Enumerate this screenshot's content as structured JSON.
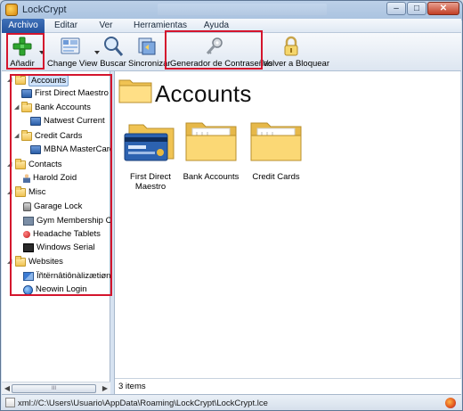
{
  "window": {
    "title": "LockCrypt",
    "minimize": "–",
    "maximize": "□",
    "close": "✕"
  },
  "menu": [
    "Archivo",
    "Editar",
    "Ver",
    "Herramientas",
    "Ayuda"
  ],
  "toolbar": {
    "add": "Añadir",
    "change_view": "Change View",
    "search": "Buscar",
    "sync": "Sincronizar",
    "password_generator": "Generador de Contraseñas",
    "lock": "Volver a Bloquear"
  },
  "tree": {
    "accounts": "Accounts",
    "first_direct": "First Direct Maestro",
    "bank_accounts": "Bank Accounts",
    "natwest": "Natwest Current",
    "credit_cards": "Credit Cards",
    "mbna": "MBNA MasterCard",
    "contacts": "Contacts",
    "harold": "Harold Zoid",
    "misc": "Misc",
    "garage": "Garage Lock",
    "gym": "Gym Membership Card",
    "headache": "Headache Tablets",
    "windows_serial": "Windows Serial",
    "websites": "Websites",
    "intl": "Ïñtërnâtiônàlizætiøn Supp",
    "neowin": "Neowin Login"
  },
  "main": {
    "title": "Accounts",
    "items": {
      "first_direct": "First Direct Maestro",
      "bank_accounts": "Bank Accounts",
      "credit_cards": "Credit Cards"
    },
    "count": "3 items"
  },
  "status": {
    "path": "xml://C:\\Users\\Usuario\\AppData\\Roaming\\LockCrypt\\LockCrypt.lce"
  },
  "colors": {
    "highlight": "#d4152d",
    "menu_active": "#2c5ca6",
    "folder": "#f0c353"
  }
}
